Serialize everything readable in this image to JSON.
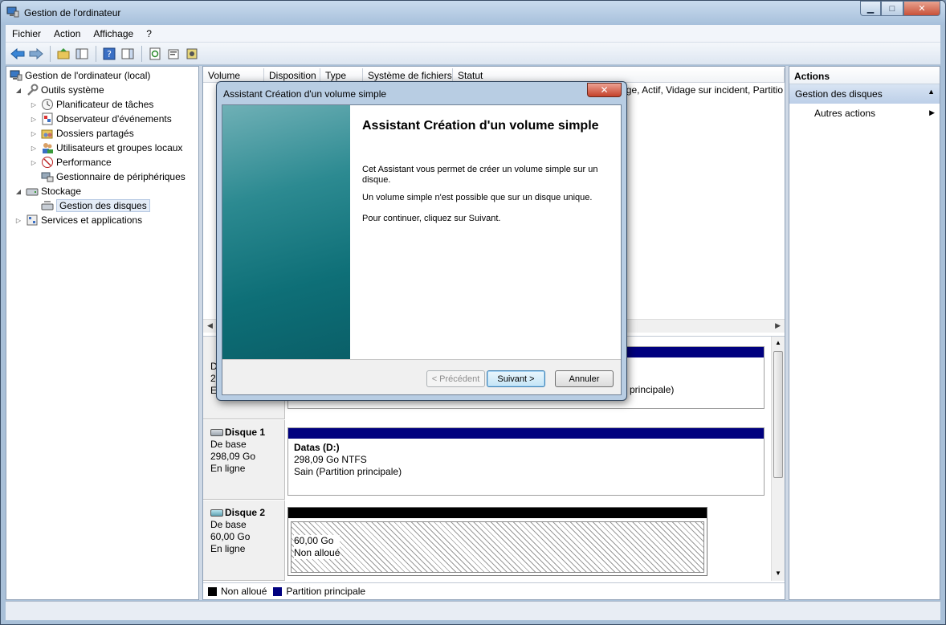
{
  "window": {
    "title": "Gestion de l'ordinateur"
  },
  "menu": [
    "Fichier",
    "Action",
    "Affichage",
    "?"
  ],
  "tree": [
    {
      "label": "Gestion de l'ordinateur (local)",
      "level": 0,
      "exp": "",
      "icon": "computer-icon"
    },
    {
      "label": "Outils système",
      "level": 1,
      "exp": "◢",
      "icon": "tools-icon"
    },
    {
      "label": "Planificateur de tâches",
      "level": 2,
      "exp": "▷",
      "icon": "clock-icon"
    },
    {
      "label": "Observateur d'événements",
      "level": 2,
      "exp": "▷",
      "icon": "event-viewer-icon"
    },
    {
      "label": "Dossiers partagés",
      "level": 2,
      "exp": "▷",
      "icon": "shared-folder-icon"
    },
    {
      "label": "Utilisateurs et groupes locaux",
      "level": 2,
      "exp": "▷",
      "icon": "users-icon"
    },
    {
      "label": "Performance",
      "level": 2,
      "exp": "▷",
      "icon": "performance-icon"
    },
    {
      "label": "Gestionnaire de périphériques",
      "level": 2,
      "exp": "",
      "icon": "device-manager-icon"
    },
    {
      "label": "Stockage",
      "level": 1,
      "exp": "◢",
      "icon": "storage-icon"
    },
    {
      "label": "Gestion des disques",
      "level": 2,
      "exp": "",
      "icon": "disk-management-icon",
      "selected": true
    },
    {
      "label": "Services et applications",
      "level": 1,
      "exp": "▷",
      "icon": "services-icon"
    }
  ],
  "volumes": {
    "columns": [
      "Volume",
      "Disposition",
      "Type",
      "Système de fichiers",
      "Statut"
    ],
    "status_visible": "ge, Actif, Vidage sur incident, Partitio"
  },
  "disks": {
    "disk0_partial": {
      "line1": "De",
      "line2": "29",
      "line3": "En",
      "partition_status": "principale)"
    },
    "disk1": {
      "name": "Disque 1",
      "kind": "De base",
      "size": "298,09 Go",
      "state": "En ligne",
      "partition": {
        "label": "Datas  (D:)",
        "size": "298,09 Go NTFS",
        "status": "Sain (Partition principale)"
      }
    },
    "disk2": {
      "name": "Disque 2",
      "kind": "De base",
      "size": "60,00 Go",
      "state": "En ligne",
      "partition": {
        "size": "60,00 Go",
        "status": "Non alloué"
      }
    }
  },
  "legend": [
    {
      "label": "Non alloué",
      "color": "#000000"
    },
    {
      "label": "Partition principale",
      "color": "#00007f"
    }
  ],
  "actions": {
    "header": "Actions",
    "section": "Gestion des disques",
    "items": [
      "Autres actions"
    ]
  },
  "dialog": {
    "title": "Assistant Création d'un volume simple",
    "heading": "Assistant Création d'un volume simple",
    "p1": "Cet Assistant vous permet de créer un volume simple sur un disque.",
    "p2": "Un volume simple n'est possible que sur un disque unique.",
    "p3": "Pour continuer, cliquez sur Suivant.",
    "btn_prev": "< Précédent",
    "btn_next": "Suivant >",
    "btn_cancel": "Annuler"
  },
  "colors": {
    "primary_partition": "#00007f",
    "unallocated": "#000000",
    "dialog_side": "#0e6f77"
  }
}
